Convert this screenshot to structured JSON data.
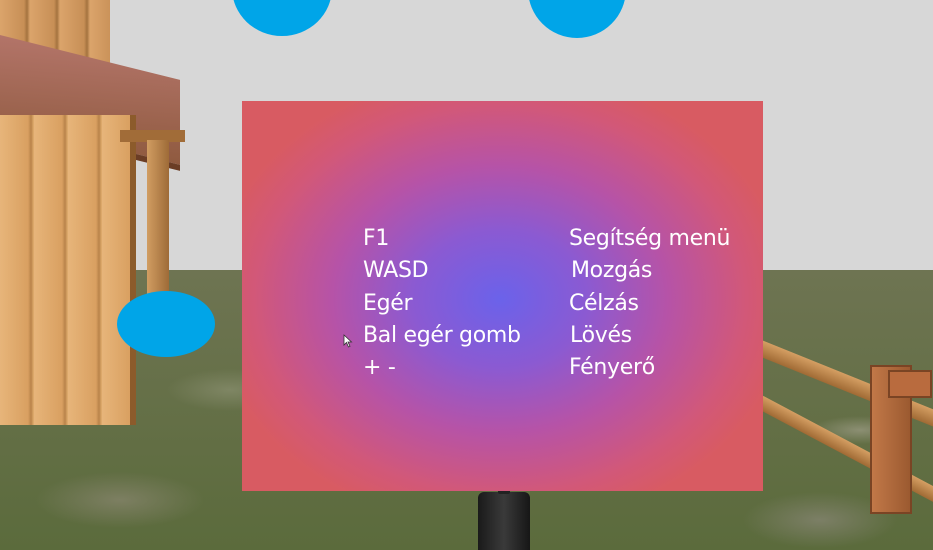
{
  "help_menu": {
    "rows": [
      {
        "key": "F1",
        "action": "Segítség menü"
      },
      {
        "key": "WASD",
        "action": "Mozgás"
      },
      {
        "key": "Egér",
        "action": "Célzás"
      },
      {
        "key": "Bal egér gomb",
        "action": "Lövés"
      },
      {
        "key": "+ -",
        "action": "Fényerő"
      }
    ]
  },
  "colors": {
    "panel_center": "#6b62ea",
    "panel_edge": "#d85b62",
    "marker_blue": "#00a5e8",
    "sky": "#d7d7d7"
  },
  "icons": {
    "cursor": "mouse-cursor-icon"
  }
}
